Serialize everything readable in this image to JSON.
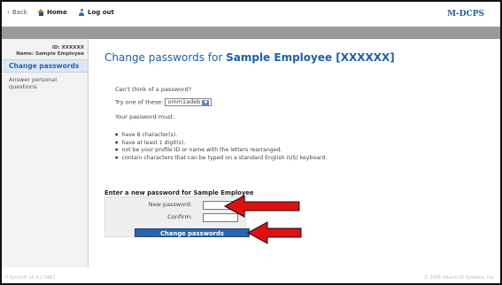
{
  "nav": {
    "back_label": "Back",
    "home_label": "Home",
    "logout_label": "Log out",
    "brand": "M-DCPS"
  },
  "sidebar": {
    "id_line": "ID: XXXXXX",
    "name_line": "Name: Sample Employee",
    "items": [
      {
        "label": "Change passwords"
      },
      {
        "label": "Answer personal questions"
      }
    ]
  },
  "main": {
    "title_prefix": "Change passwords for ",
    "title_user": "Sample Employee [XXXXXX]",
    "hint_question": "Can't think of a password?",
    "try_label": "Try one of these:",
    "suggested_password": "omm1adeb",
    "rules_intro": "Your password must:",
    "rules": [
      "have 8 character(s).",
      "have at least 1 digit(s).",
      "not be your profile ID or name with the letters rearranged.",
      "contain characters that can be typed on a standard English (US) keyboard."
    ],
    "form_title": "Enter a new password for Sample Employee",
    "new_password_label": "New password:",
    "confirm_label": "Confirm:",
    "submit_label": "Change passwords"
  },
  "footer": {
    "version": "P Synch® v6.4.2.3483",
    "copyright": "© 2006 Hitachi ID Systems, Inc."
  },
  "colors": {
    "accent": "#1d5fb0",
    "button": "#2a64ad",
    "annotation_arrow": "#e01010"
  }
}
